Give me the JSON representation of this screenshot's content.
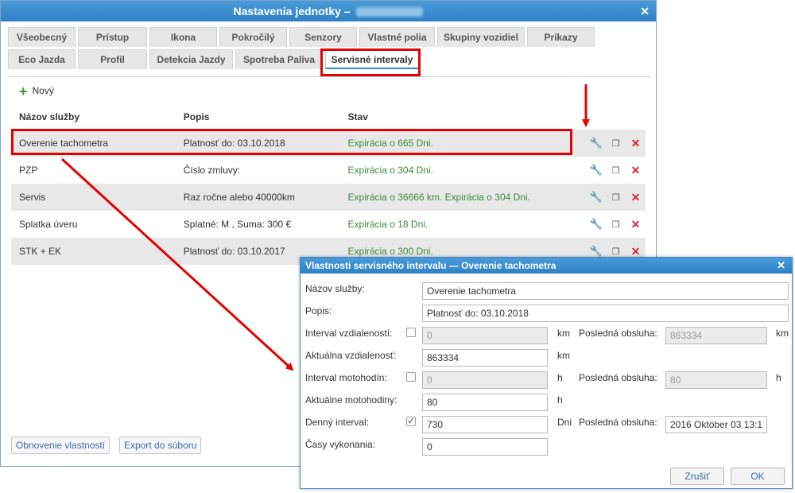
{
  "window": {
    "title": "Nastavenia jednotky –",
    "tabs_row1": [
      "Všeobecný",
      "Prístup",
      "Ikona",
      "Pokročilý",
      "Senzory",
      "Vlastné polia",
      "Skupiny vozidiel",
      "Príkazy"
    ],
    "tabs_row2": [
      "Eco Jazda",
      "Profil",
      "Detekcia Jazdy",
      "Spotreba Paliva",
      "Servisné intervaly"
    ],
    "active_tab": "Servisné intervaly",
    "new_label": "Nový",
    "columns": [
      "Názov služby",
      "Popis",
      "Stav"
    ],
    "rows": [
      {
        "name": "Overenie tachometra",
        "desc": "Platnosť do: 03.10.2018",
        "status": "Expirácia o 665 Dni."
      },
      {
        "name": "PZP",
        "desc": "Číslo zmluvy:",
        "status": "Expirácia o 304 Dni."
      },
      {
        "name": "Servis",
        "desc": "Raz ročne alebo 40000km",
        "status": "Expirácia o 36666 km. Expirácia o 304 Dni."
      },
      {
        "name": "Splatka úveru",
        "desc": "Splatné: M , Suma: 300 €",
        "status": "Expirácia o 18 Dni."
      },
      {
        "name": "STK + EK",
        "desc": "Platnosť do: 03.10.2017",
        "status": "Expirácia o 300 Dni."
      }
    ],
    "refresh_label": "Obnovenie vlastností",
    "export_label": "Export do súboru"
  },
  "dialog": {
    "title": "Vlastnosti servisného intervalu — Overenie tachometra",
    "name_label": "Názov služby:",
    "name_value": "Overenie tachometra",
    "desc_label": "Popis:",
    "desc_value": "Platnosť do: 03.10.2018",
    "dist_interval_label": "Interval vzdialeností:",
    "dist_interval_value": "0",
    "dist_unit": "km",
    "last_service_label": "Posledná obsluha:",
    "dist_last_value": "863334",
    "current_dist_label": "Aktuálna vzdialenosť:",
    "current_dist_value": "863334",
    "engine_interval_label": "Interval motohodín:",
    "engine_interval_value": "0",
    "engine_unit": "h",
    "engine_last_value": "80",
    "current_engine_label": "Aktuálne motohodiny:",
    "current_engine_value": "80",
    "daily_interval_label": "Denný interval:",
    "daily_interval_value": "730",
    "daily_unit": "Dni",
    "daily_last_value": "2016 Október 03 13:1",
    "times_label": "Časy vykonania:",
    "times_value": "0",
    "cancel_label": "Zrušiť",
    "ok_label": "OK",
    "daily_checked": true
  },
  "colors": {
    "accent": "#2f82c7",
    "highlight": "#e60000",
    "status_green": "#3c8a3c",
    "delete_red": "#d9262c"
  },
  "icons": [
    "close-icon",
    "plus-icon",
    "wrench-icon",
    "copy-icon",
    "delete-icon",
    "checkbox-icon"
  ]
}
